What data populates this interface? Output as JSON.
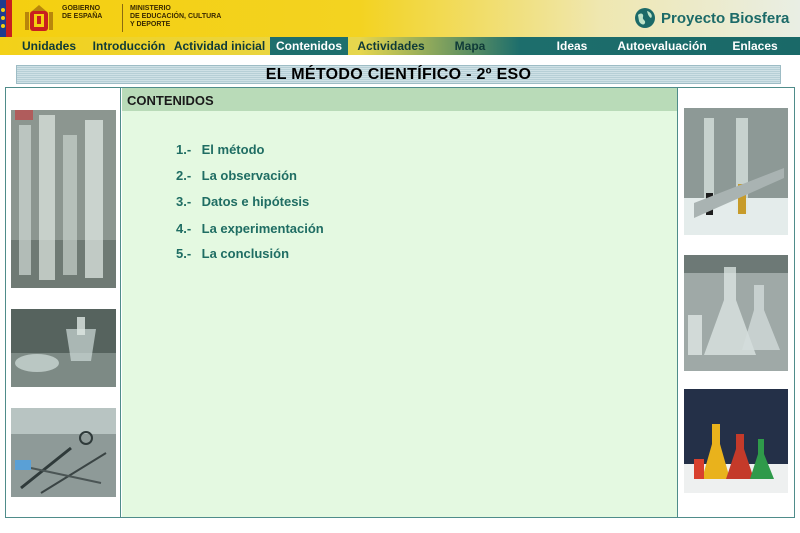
{
  "header": {
    "gov_lines": [
      "GOBIERNO",
      "DE ESPAÑA"
    ],
    "ministry_lines": [
      "MINISTERIO",
      "DE EDUCACIÓN, CULTURA",
      "Y DEPORTE"
    ],
    "brand": "Proyecto Biosfera"
  },
  "nav": {
    "items": [
      {
        "label": "Unidades"
      },
      {
        "label": "Introducción"
      },
      {
        "label": "Actividad inicial"
      },
      {
        "label": "Contenidos"
      },
      {
        "label": "Actividades"
      },
      {
        "label": "Mapa"
      },
      {
        "label": "Ideas"
      },
      {
        "label": "Autoevaluación"
      },
      {
        "label": "Enlaces"
      }
    ],
    "active": "Contenidos"
  },
  "page": {
    "title": "EL MÉTODO CIENTÍFICO - 2º ESO",
    "section": "CONTENIDOS"
  },
  "contents": [
    {
      "num": "1.-",
      "label": "El método"
    },
    {
      "num": "2.-",
      "label": "La observación"
    },
    {
      "num": "3.-",
      "label": "Datos e hipótesis"
    },
    {
      "num": "4.-",
      "label": "La experimentación"
    },
    {
      "num": "5.-",
      "label": "La conclusión"
    }
  ],
  "colors": {
    "accent": "#1e6f6d",
    "link": "#1f6d63",
    "content_bg": "#e4f9e1",
    "section_head_bg": "#b9dbb8"
  },
  "icons": {
    "brand": "globe-icon",
    "government": "coat-of-arms-icon"
  }
}
